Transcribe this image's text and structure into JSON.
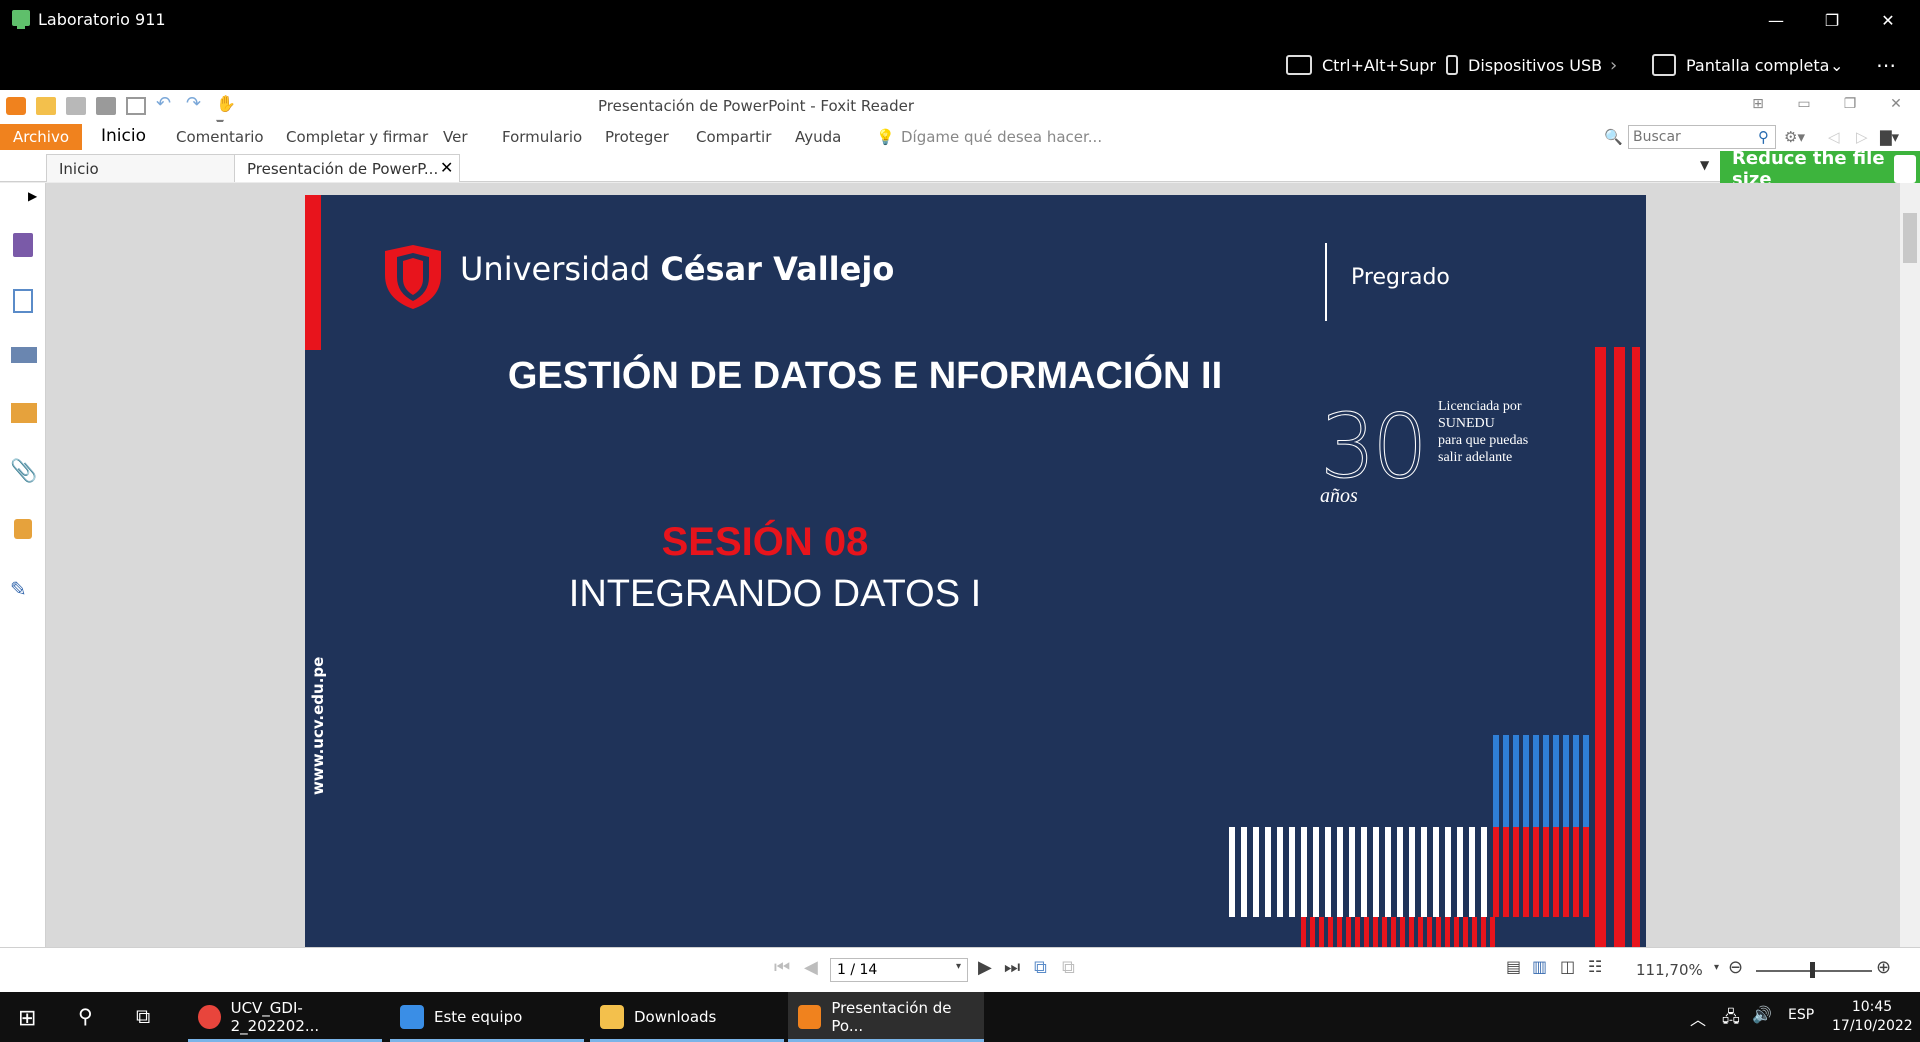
{
  "rd": {
    "title": "Laboratorio 911",
    "toolbar": {
      "ctrl_alt_del": "Ctrl+Alt+Supr",
      "usb": "Dispositivos USB",
      "fullscreen": "Pantalla completa"
    }
  },
  "foxit": {
    "doc_title": "Presentación de PowerPoint - Foxit Reader",
    "ribbon": {
      "archivo": "Archivo",
      "tabs": [
        "Inicio",
        "Comentario",
        "Completar y firmar",
        "Ver",
        "Formulario",
        "Proteger",
        "Compartir",
        "Ayuda"
      ],
      "tell_me": "Dígame qué desea hacer...",
      "search_placeholder": "Buscar"
    },
    "doc_tabs": [
      "Inicio",
      "Presentación de PowerP..."
    ],
    "reduce_banner": "Reduce the file size",
    "page_field": "1 / 14",
    "zoom": "111,70%",
    "zoom_level": 0.48
  },
  "slide": {
    "university_light": "Universidad ",
    "university_bold": "César Vallejo",
    "program": "Pregrado",
    "title": "GESTIÓN DE DATOS E NFORMACIÓN  II",
    "years_number": "30",
    "years_word": "años",
    "license_lines": [
      "Licenciada por",
      "SUNEDU",
      "para que puedas",
      "salir adelante"
    ],
    "session": "SESIÓN 08",
    "subtitle": "INTEGRANDO DATOS I",
    "website": "www.ucv.edu.pe"
  },
  "taskbar": {
    "apps": [
      {
        "label": "UCV_GDI-2_202202..."
      },
      {
        "label": "Este equipo"
      },
      {
        "label": "Downloads"
      },
      {
        "label": "Presentación de Po..."
      }
    ],
    "language": "ESP",
    "time": "10:45",
    "date": "17/10/2022"
  },
  "colors": {
    "accent_orange": "#f0821e",
    "slide_navy": "#1f3359",
    "ucv_red": "#e8141c",
    "banner_green": "#3db43d"
  }
}
